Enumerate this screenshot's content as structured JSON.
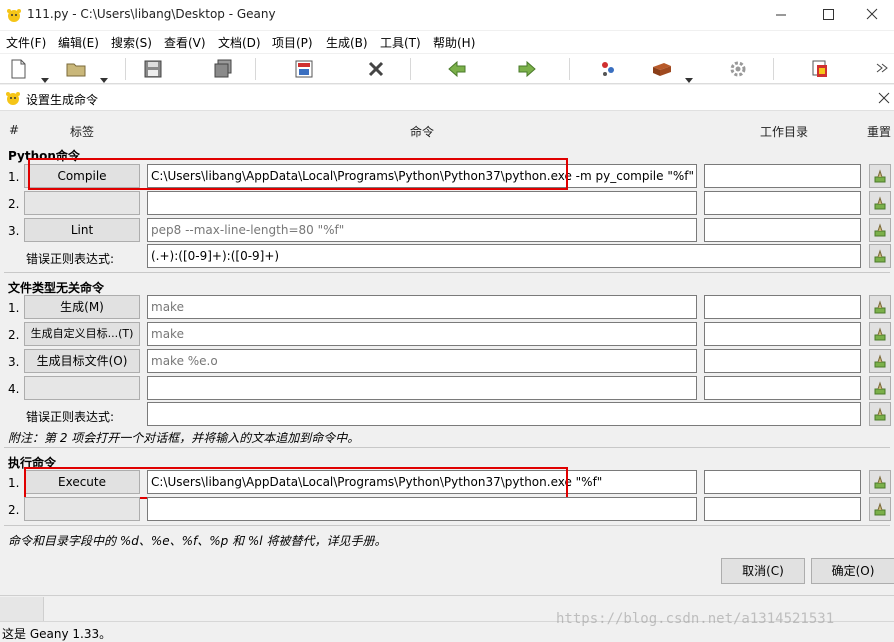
{
  "window": {
    "title": "111.py - C:\\Users\\libang\\Desktop - Geany"
  },
  "menu": [
    "文件(F)",
    "编辑(E)",
    "搜索(S)",
    "查看(V)",
    "文档(D)",
    "项目(P)",
    "生成(B)",
    "工具(T)",
    "帮助(H)"
  ],
  "dialog": {
    "title": "设置生成命令",
    "columns": {
      "num": "#",
      "label": "标签",
      "command": "命令",
      "workdir": "工作目录",
      "reset": "重置"
    },
    "python_section": {
      "header": "Python命令",
      "rows": [
        {
          "num": "1.",
          "label": "Compile",
          "command": "C:\\Users\\libang\\AppData\\Local\\Programs\\Python\\Python37\\python.exe -m py_compile \"%f\"",
          "workdir": ""
        },
        {
          "num": "2.",
          "label": "",
          "command": "",
          "workdir": ""
        },
        {
          "num": "3.",
          "label": "Lint",
          "command": "pep8 --max-line-length=80 \"%f\"",
          "workdir": ""
        }
      ],
      "error_label": "错误正则表达式:",
      "error_regex": "(.+):([0-9]+):([0-9]+)"
    },
    "independent_section": {
      "header": "文件类型无关命令",
      "rows": [
        {
          "num": "1.",
          "label": "生成(M)",
          "command": "make",
          "workdir": ""
        },
        {
          "num": "2.",
          "label": "生成自定义目标...(T)",
          "command": "make",
          "workdir": ""
        },
        {
          "num": "3.",
          "label": "生成目标文件(O)",
          "command": "make %e.o",
          "workdir": ""
        },
        {
          "num": "4.",
          "label": "",
          "command": "",
          "workdir": ""
        }
      ],
      "error_label": "错误正则表达式:",
      "error_regex": "",
      "note": "附注：第 2 项会打开一个对话框，并将输入的文本追加到命令中。"
    },
    "exec_section": {
      "header": "执行命令",
      "rows": [
        {
          "num": "1.",
          "label": "Execute",
          "command": "C:\\Users\\libang\\AppData\\Local\\Programs\\Python\\Python37\\python.exe \"%f\"",
          "workdir": ""
        },
        {
          "num": "2.",
          "label": "",
          "command": "",
          "workdir": ""
        }
      ]
    },
    "footer_note": "命令和目录字段中的 %d、%e、%f、%p 和 %l 将被替代，详见手册。",
    "cancel_label": "取消(C)",
    "ok_label": "确定(O)"
  },
  "statusbar": {
    "text": "这是 Geany 1.33。"
  },
  "watermark": "https://blog.csdn.net/a1314521531",
  "colors": {
    "highlight": "#e00000"
  }
}
